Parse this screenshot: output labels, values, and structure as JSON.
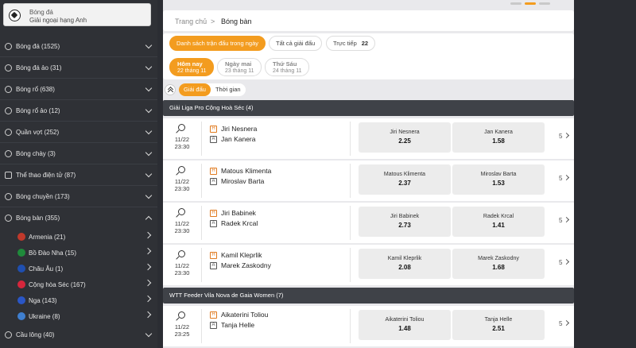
{
  "featured": {
    "line1": "Bóng đá",
    "line2": "Giải ngoại hạng Anh"
  },
  "sidebar": {
    "items": [
      {
        "label": "Bóng đá (1525)",
        "icon": "soccer-ball-icon"
      },
      {
        "label": "Bóng đá ảo (31)",
        "icon": "soccer-ball-icon"
      },
      {
        "label": "Bóng rổ (638)",
        "icon": "basketball-icon"
      },
      {
        "label": "Bóng rổ ảo (12)",
        "icon": "basketball-icon"
      },
      {
        "label": "Quần vợt (252)",
        "icon": "tennis-icon"
      },
      {
        "label": "Bóng chày (3)",
        "icon": "baseball-icon"
      },
      {
        "label": "Thể thao điện tử (87)",
        "icon": "gamepad-icon"
      },
      {
        "label": "Bóng chuyền (173)",
        "icon": "volleyball-icon"
      },
      {
        "label": "Bóng bàn (355)",
        "icon": "table-tennis-icon"
      }
    ],
    "subitems": [
      {
        "label": "Armenia (21)",
        "flag_color": "#c0392b"
      },
      {
        "label": "Bồ Đào Nha (15)",
        "flag_color": "#1f8a3b"
      },
      {
        "label": "Châu Âu (1)",
        "flag_color": "#1f4fb0"
      },
      {
        "label": "Cộng hòa Séc (167)",
        "flag_color": "#d6263c"
      },
      {
        "label": "Nga (143)",
        "flag_color": "#2a56c6"
      },
      {
        "label": "Ukraine (8)",
        "flag_color": "#3f7fd0"
      }
    ],
    "last_item": {
      "label": "Cầu lông (40)",
      "icon": "badminton-icon"
    }
  },
  "breadcrumb": {
    "home": "Trang chủ",
    "sep": ">",
    "current": "Bóng bàn"
  },
  "filters": {
    "today_list": "Danh sách trận đấu trong ngày",
    "all_leagues": "Tất cả giải đấu",
    "live": "Trực tiếp",
    "live_count": "22"
  },
  "days": [
    {
      "d1": "Hôm nay",
      "d2": "22 tháng 11"
    },
    {
      "d1": "Ngày mai",
      "d2": "23 tháng 11"
    },
    {
      "d1": "Thứ Sáu",
      "d2": "24 tháng 11"
    }
  ],
  "sort_tabs": {
    "league": "Giải đấu",
    "time": "Thời gian"
  },
  "leagues": [
    {
      "name": "Giải Liga Pro Cộng Hoà Séc (4)",
      "matches": [
        {
          "date": "11/22",
          "time": "23:30",
          "home": "Jiri Nesnera",
          "away": "Jan Kanera",
          "odd_home": "2.25",
          "odd_away": "1.58",
          "more": "5"
        },
        {
          "date": "11/22",
          "time": "23:30",
          "home": "Matous Klimenta",
          "away": "Miroslav Barta",
          "odd_home": "2.37",
          "odd_away": "1.53",
          "more": "5"
        },
        {
          "date": "11/22",
          "time": "23:30",
          "home": "Jiri Babinek",
          "away": "Radek Krcal",
          "odd_home": "2.73",
          "odd_away": "1.41",
          "more": "5"
        },
        {
          "date": "11/22",
          "time": "23:30",
          "home": "Kamil Kleprlik",
          "away": "Marek Zaskodny",
          "odd_home": "2.08",
          "odd_away": "1.68",
          "more": "5"
        }
      ]
    },
    {
      "name": "WTT Feeder Vila Nova de Gaia Women (7)",
      "matches": [
        {
          "date": "11/22",
          "time": "23:25",
          "home": "Aikaterini Toliou",
          "away": "Tanja Helle",
          "odd_home": "1.48",
          "odd_away": "2.51",
          "more": "5"
        }
      ]
    }
  ],
  "badges": {
    "home": "H",
    "away": "A"
  },
  "colors": {
    "accent": "#f39c1f",
    "sidebar_bg": "#2f3136",
    "league_bar": "#3f4248"
  }
}
